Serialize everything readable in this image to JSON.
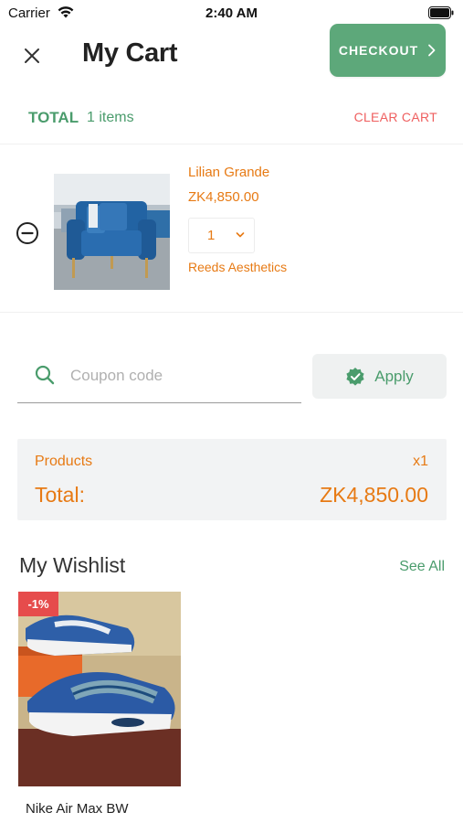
{
  "status_bar": {
    "carrier": "Carrier",
    "time": "2:40 AM"
  },
  "header": {
    "title": "My Cart",
    "checkout_label": "CHECKOUT"
  },
  "summary": {
    "total_label": "TOTAL",
    "items_count": "1 items",
    "clear_cart_label": "CLEAR CART"
  },
  "cart_items": [
    {
      "name": "Lilian Grande",
      "price": "ZK4,850.00",
      "quantity": "1",
      "seller": "Reeds Aesthetics"
    }
  ],
  "coupon": {
    "placeholder": "Coupon code",
    "apply_label": "Apply"
  },
  "totals": {
    "products_label": "Products",
    "products_count": "x1",
    "total_label": "Total:",
    "total_amount": "ZK4,850.00"
  },
  "wishlist": {
    "title": "My Wishlist",
    "see_all_label": "See All",
    "items": [
      {
        "name": "Nike Air Max BW",
        "discount": "-1%"
      }
    ]
  },
  "colors": {
    "accent_green": "#5da87a",
    "text_green": "#4a9c6c",
    "orange": "#e77a14",
    "red": "#ef5f5f",
    "badge_red": "#e64c4c"
  },
  "icons": [
    "wifi-icon",
    "battery-icon",
    "close-icon",
    "chevron-right-icon",
    "remove-circle-icon",
    "chevron-down-icon",
    "search-icon",
    "verified-check-icon"
  ]
}
